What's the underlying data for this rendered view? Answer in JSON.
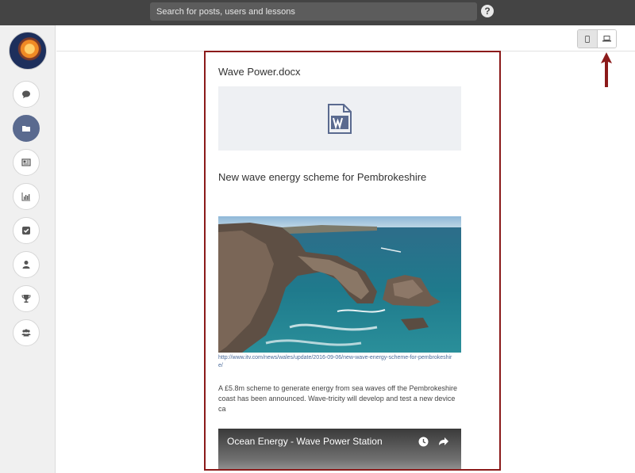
{
  "search": {
    "placeholder": "Search for posts, users and lessons"
  },
  "help": {
    "label": "?"
  },
  "sidebar": {
    "items": [
      {
        "icon": "chat-icon"
      },
      {
        "icon": "folder-icon",
        "active": true
      },
      {
        "icon": "newspaper-icon"
      },
      {
        "icon": "bar-chart-icon"
      },
      {
        "icon": "checkbox-icon"
      },
      {
        "icon": "user-icon"
      },
      {
        "icon": "trophy-icon"
      },
      {
        "icon": "group-icon"
      }
    ]
  },
  "view_toggle": {
    "options": [
      "mobile-icon",
      "laptop-icon"
    ],
    "selected": "mobile"
  },
  "preview": {
    "attachment": {
      "filename": "Wave Power.docx",
      "icon": "word-document-icon"
    },
    "article": {
      "title": "New wave energy scheme for Pembrokeshire",
      "link": "http://www.itv.com/news/wales/update/2016-09-06/new-wave-energy-scheme-for-pembrokeshire/",
      "summary": "A £5.8m scheme to generate energy from sea waves off the Pembrokeshire coast has been announced. Wave-tricity will develop and test a new device ca"
    },
    "video": {
      "title": "Ocean Energy - Wave Power Station"
    }
  },
  "colors": {
    "frame": "#8b1a1a",
    "arrow": "#8b1a1a",
    "active_nav": "#5a6a8f",
    "topbar": "#444444"
  }
}
